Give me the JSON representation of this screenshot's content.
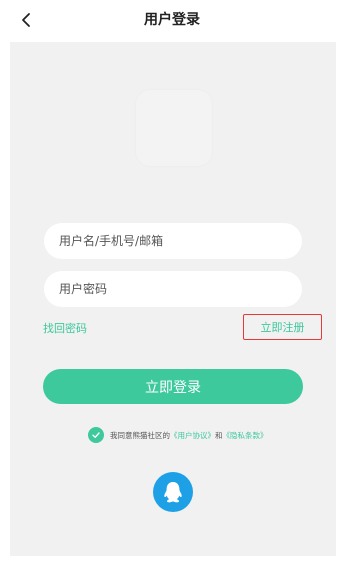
{
  "header": {
    "title": "用户登录",
    "back_icon": "chevron-left-icon"
  },
  "form": {
    "username_placeholder": "用户名/手机号/邮箱",
    "password_placeholder": "用户密码",
    "forgot_label": "找回密码",
    "register_label": "立即注册",
    "login_label": "立即登录"
  },
  "agreement": {
    "checked": true,
    "prefix": "我同意熊猫社区的",
    "user_agreement": "《用户协议》",
    "conjunction": "和",
    "privacy_policy": "《隐私条款》"
  },
  "social": {
    "qq_icon": "qq-penguin-icon"
  },
  "colors": {
    "accent": "#3ec99d",
    "link": "#3cc79c",
    "highlight_border": "#e53935",
    "qq_blue": "#1ea0e6",
    "content_bg": "#f1f1f1"
  }
}
